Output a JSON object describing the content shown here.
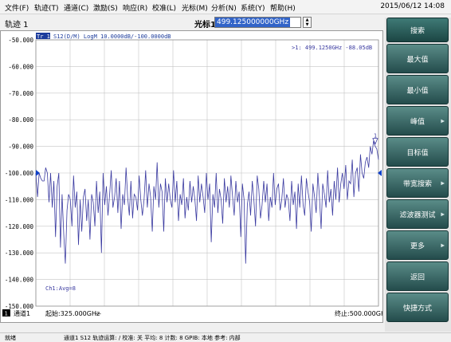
{
  "menu": {
    "items": [
      "文件(F)",
      "轨迹(T)",
      "通道(C)",
      "激励(S)",
      "响应(R)",
      "校准(L)",
      "光标(M)",
      "分析(N)",
      "系统(Y)",
      "帮助(H)"
    ],
    "datetime": "2015/06/12 14:08"
  },
  "toolbar": {
    "trace_label": "轨迹 1",
    "marker_label": "光标1",
    "marker_value": "499.125000000GHz"
  },
  "plot": {
    "trace_tag": "Tr 1",
    "trace_info": "S12(D/M) LogM 10.0000dB/-100.0000dB",
    "marker_readout": ">1:  499.1250GHz  -88.05dB",
    "marker_number": "1",
    "avg_label": "Ch1:Avg=8",
    "y_labels": [
      "-50.000",
      "-60.000",
      "-70.000",
      "-80.000",
      "-90.000",
      "-100.000",
      "-110.000",
      "-120.000",
      "-130.000",
      "-140.000",
      "-150.000"
    ],
    "channel_num": "1",
    "channel_label": "通道1",
    "start_label": "起始:325.000GHz",
    "start_dash": "—",
    "stop_label": "终止:500.000GHz",
    "colors": {
      "trace": "#3a3aa0",
      "grid": "#c4c4c4",
      "reference": "#1040c8"
    },
    "trace_dB": [
      -100,
      -109,
      -100,
      -102,
      -103,
      -103,
      -98,
      -100,
      -111,
      -100,
      -113,
      -103,
      -124,
      -105,
      -100,
      -128,
      -108,
      -123,
      -134,
      -114,
      -108,
      -110,
      -120,
      -101,
      -113,
      -107,
      -127,
      -110,
      -122,
      -109,
      -106,
      -118,
      -110,
      -125,
      -108,
      -111,
      -120,
      -103,
      -115,
      -107,
      -130,
      -100,
      -112,
      -105,
      -116,
      -108,
      -99,
      -113,
      -109,
      -102,
      -115,
      -103,
      -121,
      -108,
      -112,
      -98,
      -109,
      -116,
      -103,
      -117,
      -108,
      -109,
      -114,
      -101,
      -110,
      -116,
      -110,
      -99,
      -113,
      -104,
      -109,
      -122,
      -105,
      -110,
      -96,
      -113,
      -104,
      -107,
      -122,
      -102,
      -111,
      -104,
      -110,
      -113,
      -99,
      -111,
      -103,
      -118,
      -108,
      -112,
      -102,
      -117,
      -109,
      -114,
      -103,
      -111,
      -105,
      -110,
      -118,
      -101,
      -111,
      -104,
      -109,
      -115,
      -100,
      -110,
      -104,
      -126,
      -108,
      -113,
      -100,
      -115,
      -106,
      -110,
      -119,
      -102,
      -111,
      -105,
      -113,
      -101,
      -109,
      -116,
      -103,
      -111,
      -107,
      -124,
      -104,
      -110,
      -134,
      -112,
      -107,
      -116,
      -103,
      -110,
      -120,
      -101,
      -106,
      -117,
      -112,
      -103,
      -111,
      -104,
      -118,
      -109,
      -113,
      -100,
      -112,
      -106,
      -104,
      -114,
      -110,
      -102,
      -113,
      -108,
      -110,
      -118,
      -103,
      -112,
      -107,
      -121,
      -104,
      -113,
      -101,
      -112,
      -116,
      -102,
      -107,
      -111,
      -122,
      -104,
      -109,
      -115,
      -100,
      -109,
      -121,
      -104,
      -108,
      -113,
      -99,
      -111,
      -106,
      -116,
      -103,
      -110,
      -98,
      -111,
      -104,
      -100,
      -106,
      -97,
      -110,
      -103,
      -104,
      -95,
      -109,
      -100,
      -98,
      -107,
      -93,
      -100,
      -102,
      -96,
      -94,
      -98,
      -90,
      -93,
      -88,
      -90,
      -91,
      -95
    ]
  },
  "softkeys": [
    {
      "label": "搜索",
      "arrow": ""
    },
    {
      "label": "最大值",
      "arrow": ""
    },
    {
      "label": "最小值",
      "arrow": ""
    },
    {
      "label": "峰值",
      "arrow": "▶"
    },
    {
      "label": "目标值",
      "arrow": ""
    },
    {
      "label": "带宽搜索",
      "arrow": "▶"
    },
    {
      "label": "滤波器测试",
      "arrow": "▶"
    },
    {
      "label": "更多",
      "arrow": "▶"
    },
    {
      "label": "返回",
      "arrow": ""
    },
    {
      "label": "快捷方式",
      "arrow": ""
    }
  ],
  "statusbar": {
    "state": "就绪",
    "info": "通道1  S12  轨迹运算: /  校准: 关  平均: 8 计数: 8  GPIB: 本地  参考: 内部"
  }
}
